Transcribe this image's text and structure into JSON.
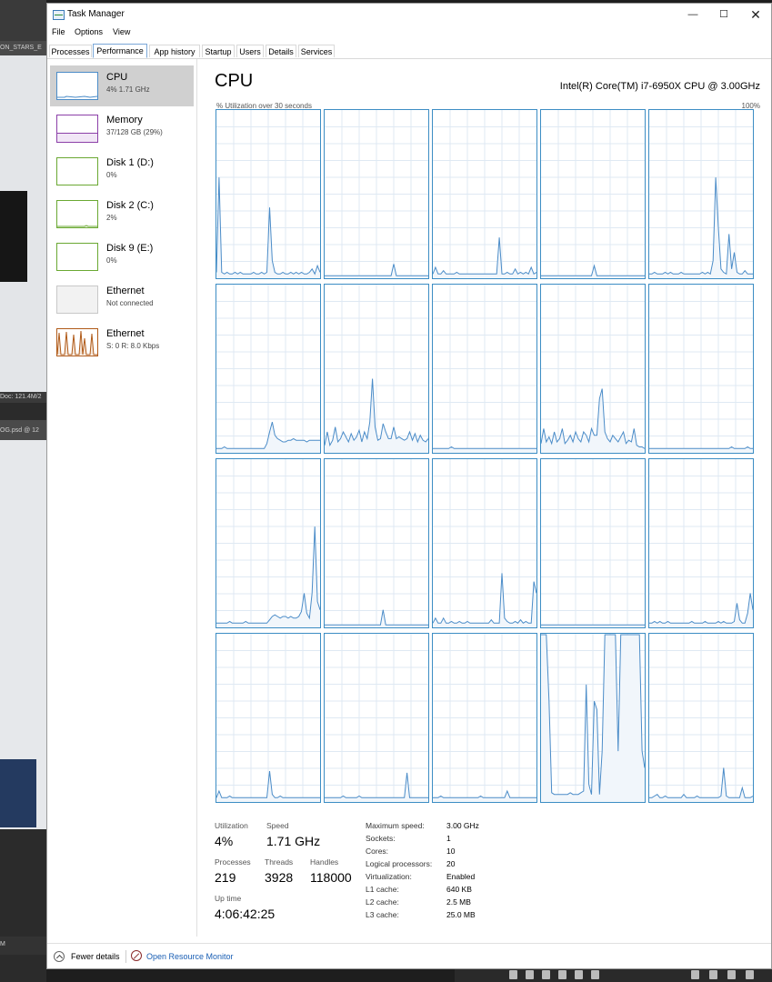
{
  "window": {
    "title": "Task Manager"
  },
  "menu": {
    "file": "File",
    "options": "Options",
    "view": "View"
  },
  "tabs": [
    "Processes",
    "Performance",
    "App history",
    "Startup",
    "Users",
    "Details",
    "Services"
  ],
  "active_tab": "Performance",
  "sidebar": [
    {
      "title": "CPU",
      "sub": "4% 1.71 GHz",
      "color": "#4b8cc8"
    },
    {
      "title": "Memory",
      "sub": "37/128 GB (29%)",
      "color": "#8b3fa8"
    },
    {
      "title": "Disk 1 (D:)",
      "sub": "0%",
      "color": "#6aa832"
    },
    {
      "title": "Disk 2 (C:)",
      "sub": "2%",
      "color": "#6aa832"
    },
    {
      "title": "Disk 9 (E:)",
      "sub": "0%",
      "color": "#6aa832"
    },
    {
      "title": "Ethernet",
      "sub": "Not connected",
      "color": "#b0b0b0"
    },
    {
      "title": "Ethernet",
      "sub": "S: 0 R: 8.0 Kbps",
      "color": "#b05a18"
    }
  ],
  "cpu": {
    "title": "CPU",
    "model": "Intel(R) Core(TM) i7-6950X CPU @ 3.00GHz",
    "util_label": "% Utilization over 30 seconds",
    "util_max": "100%"
  },
  "stats": {
    "utilization_label": "Utilization",
    "utilization": "4%",
    "speed_label": "Speed",
    "speed": "1.71 GHz",
    "processes_label": "Processes",
    "processes": "219",
    "threads_label": "Threads",
    "threads": "3928",
    "handles_label": "Handles",
    "handles": "118000",
    "uptime_label": "Up time",
    "uptime": "4:06:42:25"
  },
  "specs": [
    {
      "label": "Maximum speed:",
      "value": "3.00 GHz"
    },
    {
      "label": "Sockets:",
      "value": "1"
    },
    {
      "label": "Cores:",
      "value": "10"
    },
    {
      "label": "Logical processors:",
      "value": "20"
    },
    {
      "label": "Virtualization:",
      "value": "Enabled"
    },
    {
      "label": "L1 cache:",
      "value": "640 KB"
    },
    {
      "label": "L2 cache:",
      "value": "2.5 MB"
    },
    {
      "label": "L3 cache:",
      "value": "25.0 MB"
    }
  ],
  "footer": {
    "fewer_details": "Fewer details",
    "resource_monitor": "Open Resource Monitor"
  },
  "background": {
    "label1": "ON_STARS_E",
    "label2": "Doc: 121.4M/2",
    "label3": "OG.psd @ 12",
    "label4": "M"
  },
  "chart_data": {
    "type": "line",
    "title": "CPU",
    "ylim": [
      0,
      100
    ],
    "grid": true,
    "series": [
      {
        "values": [
          3,
          60,
          3,
          2,
          3,
          2,
          2,
          3,
          2,
          3,
          2,
          2,
          2,
          2,
          3,
          2,
          2,
          3,
          2,
          3,
          42,
          10,
          3,
          2,
          2,
          3,
          2,
          2,
          3,
          2,
          3,
          2,
          3,
          2,
          2,
          3,
          5,
          2,
          7,
          3
        ]
      },
      {
        "values": [
          1,
          1,
          1,
          1,
          1,
          1,
          1,
          1,
          1,
          1,
          1,
          1,
          1,
          1,
          1,
          1,
          1,
          1,
          1,
          1,
          1,
          1,
          1,
          1,
          1,
          1,
          8,
          1,
          1,
          1,
          1,
          1,
          1,
          1,
          1,
          1,
          1,
          1,
          1,
          1
        ]
      },
      {
        "values": [
          2,
          6,
          2,
          2,
          4,
          2,
          2,
          2,
          2,
          3,
          2,
          2,
          2,
          2,
          2,
          2,
          2,
          2,
          2,
          2,
          2,
          2,
          2,
          2,
          2,
          24,
          2,
          2,
          3,
          2,
          2,
          5,
          2,
          3,
          2,
          3,
          2,
          6,
          2,
          3
        ]
      },
      {
        "values": [
          1,
          1,
          1,
          1,
          1,
          1,
          1,
          1,
          1,
          1,
          1,
          1,
          1,
          1,
          1,
          1,
          1,
          1,
          1,
          1,
          7,
          1,
          1,
          1,
          1,
          1,
          1,
          1,
          1,
          1,
          1,
          1,
          1,
          1,
          1,
          1,
          1,
          1,
          1,
          1
        ]
      },
      {
        "values": [
          2,
          2,
          3,
          2,
          2,
          2,
          3,
          2,
          3,
          2,
          2,
          2,
          3,
          2,
          2,
          2,
          2,
          2,
          2,
          2,
          3,
          2,
          3,
          2,
          10,
          60,
          30,
          5,
          3,
          2,
          26,
          5,
          15,
          3,
          2,
          2,
          4,
          2,
          2,
          2
        ]
      },
      {
        "values": [
          2,
          2,
          2,
          3,
          2,
          2,
          2,
          2,
          2,
          2,
          2,
          2,
          2,
          2,
          2,
          2,
          2,
          2,
          2,
          5,
          12,
          18,
          10,
          8,
          7,
          6,
          6,
          7,
          7,
          8,
          7,
          7,
          7,
          7,
          6,
          7,
          7,
          7,
          7,
          7
        ]
      },
      {
        "values": [
          4,
          12,
          4,
          7,
          15,
          6,
          8,
          12,
          9,
          6,
          11,
          7,
          9,
          13,
          6,
          12,
          8,
          18,
          44,
          15,
          7,
          8,
          17,
          12,
          8,
          8,
          15,
          8,
          9,
          8,
          7,
          8,
          12,
          7,
          11,
          6,
          10,
          7,
          6,
          8
        ]
      },
      {
        "values": [
          2,
          2,
          2,
          2,
          2,
          2,
          2,
          3,
          2,
          2,
          2,
          2,
          2,
          2,
          2,
          2,
          2,
          2,
          2,
          2,
          2,
          2,
          2,
          2,
          2,
          2,
          2,
          2,
          2,
          2,
          2,
          2,
          2,
          2,
          2,
          2,
          2,
          2,
          2,
          2
        ]
      },
      {
        "values": [
          5,
          14,
          6,
          9,
          5,
          12,
          6,
          8,
          14,
          5,
          7,
          10,
          6,
          12,
          8,
          6,
          12,
          10,
          6,
          14,
          10,
          10,
          32,
          38,
          12,
          8,
          6,
          10,
          8,
          6,
          9,
          12,
          5,
          7,
          6,
          14,
          4,
          3,
          3,
          2
        ]
      },
      {
        "values": [
          2,
          2,
          2,
          2,
          2,
          2,
          2,
          2,
          2,
          2,
          2,
          2,
          2,
          2,
          2,
          2,
          2,
          2,
          2,
          2,
          2,
          2,
          2,
          2,
          2,
          2,
          2,
          2,
          2,
          2,
          2,
          3,
          2,
          2,
          2,
          2,
          2,
          3,
          2,
          2
        ]
      },
      {
        "values": [
          2,
          2,
          2,
          2,
          2,
          3,
          2,
          2,
          2,
          2,
          2,
          3,
          2,
          2,
          2,
          2,
          2,
          2,
          2,
          2,
          4,
          6,
          7,
          6,
          5,
          6,
          6,
          5,
          6,
          5,
          5,
          6,
          9,
          20,
          8,
          5,
          20,
          60,
          15,
          10
        ]
      },
      {
        "values": [
          1,
          1,
          1,
          1,
          1,
          1,
          1,
          1,
          1,
          1,
          1,
          1,
          1,
          1,
          1,
          1,
          1,
          1,
          1,
          1,
          1,
          1,
          10,
          1,
          1,
          1,
          1,
          1,
          1,
          1,
          1,
          1,
          1,
          1,
          1,
          1,
          1,
          1,
          1,
          1
        ]
      },
      {
        "values": [
          2,
          5,
          2,
          2,
          5,
          2,
          2,
          3,
          2,
          2,
          3,
          2,
          2,
          3,
          2,
          2,
          2,
          2,
          2,
          2,
          2,
          2,
          4,
          2,
          2,
          2,
          32,
          5,
          3,
          2,
          2,
          3,
          2,
          4,
          2,
          3,
          2,
          2,
          27,
          20
        ]
      },
      {
        "values": [
          1,
          1,
          1,
          1,
          1,
          1,
          1,
          1,
          1,
          1,
          1,
          1,
          1,
          1,
          1,
          1,
          1,
          1,
          1,
          1,
          1,
          1,
          1,
          1,
          1,
          1,
          1,
          1,
          1,
          1,
          1,
          1,
          1,
          1,
          1,
          1,
          1,
          1,
          1,
          1
        ]
      },
      {
        "values": [
          2,
          2,
          3,
          2,
          3,
          2,
          2,
          3,
          2,
          2,
          2,
          2,
          2,
          2,
          2,
          2,
          3,
          2,
          2,
          2,
          2,
          3,
          2,
          2,
          2,
          2,
          3,
          2,
          3,
          2,
          2,
          2,
          3,
          14,
          4,
          2,
          2,
          8,
          20,
          10
        ]
      },
      {
        "values": [
          2,
          6,
          2,
          2,
          2,
          3,
          2,
          2,
          2,
          2,
          2,
          2,
          2,
          2,
          2,
          2,
          2,
          2,
          2,
          2,
          18,
          4,
          2,
          2,
          3,
          2,
          2,
          2,
          2,
          2,
          2,
          2,
          2,
          2,
          2,
          2,
          2,
          2,
          2,
          2
        ]
      },
      {
        "values": [
          2,
          2,
          2,
          2,
          2,
          2,
          2,
          3,
          2,
          2,
          2,
          2,
          2,
          3,
          2,
          2,
          2,
          2,
          2,
          2,
          2,
          2,
          2,
          2,
          2,
          2,
          2,
          2,
          2,
          2,
          2,
          17,
          2,
          2,
          2,
          2,
          2,
          2,
          2,
          2
        ]
      },
      {
        "values": [
          2,
          2,
          2,
          3,
          2,
          2,
          2,
          2,
          2,
          2,
          2,
          2,
          2,
          2,
          2,
          2,
          2,
          2,
          3,
          2,
          2,
          2,
          2,
          2,
          2,
          2,
          2,
          2,
          6,
          2,
          2,
          2,
          2,
          2,
          2,
          2,
          2,
          2,
          2,
          2
        ]
      },
      {
        "values": [
          100,
          100,
          100,
          60,
          5,
          4,
          4,
          4,
          4,
          4,
          4,
          5,
          4,
          4,
          4,
          5,
          6,
          70,
          10,
          4,
          60,
          55,
          4,
          30,
          100,
          100,
          100,
          100,
          100,
          30,
          100,
          100,
          100,
          100,
          100,
          100,
          100,
          100,
          30,
          20
        ]
      },
      {
        "values": [
          2,
          2,
          3,
          4,
          2,
          2,
          3,
          2,
          2,
          2,
          2,
          2,
          2,
          4,
          2,
          2,
          2,
          2,
          3,
          2,
          2,
          2,
          2,
          2,
          2,
          2,
          2,
          3,
          20,
          3,
          2,
          2,
          2,
          2,
          2,
          8,
          2,
          2,
          2,
          3
        ]
      }
    ]
  }
}
